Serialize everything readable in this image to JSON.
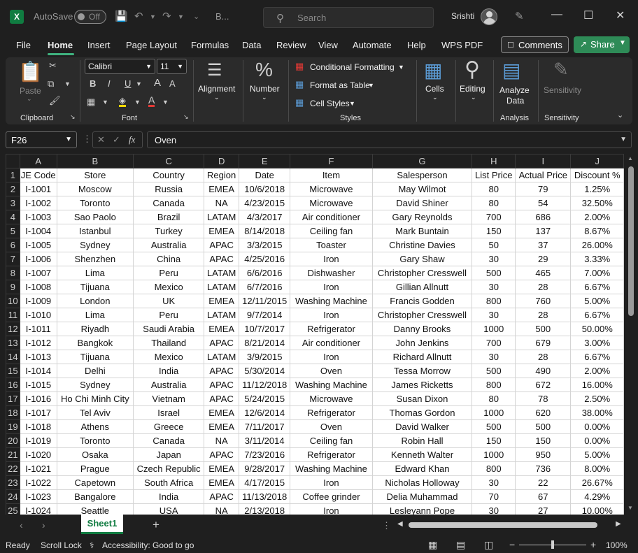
{
  "titlebar": {
    "app_icon": "X",
    "autosave_label": "AutoSave",
    "autosave_state": "Off",
    "file_name": "B...",
    "search_placeholder": "Search",
    "user_name": "Srishti"
  },
  "menu": [
    "File",
    "Home",
    "Insert",
    "Page Layout",
    "Formulas",
    "Data",
    "Review",
    "View",
    "Automate",
    "Help",
    "WPS PDF"
  ],
  "menu_active": "Home",
  "comments_label": "Comments",
  "share_label": "Share",
  "ribbon": {
    "paste_label": "Paste",
    "clipboard_label": "Clipboard",
    "font_name": "Calibri",
    "font_size": "11",
    "font_label": "Font",
    "bold": "B",
    "italic": "I",
    "underline": "U",
    "grow_font": "A",
    "shrink_font": "A",
    "alignment_label": "Alignment",
    "number_label": "Number",
    "conditional_formatting": "Conditional Formatting",
    "format_as_table": "Format as Table",
    "cell_styles": "Cell Styles",
    "styles_label": "Styles",
    "cells_label": "Cells",
    "editing_label": "Editing",
    "analyze_data_line1": "Analyze",
    "analyze_data_line2": "Data",
    "analysis_label": "Analysis",
    "sensitivity_btn": "Sensitivity",
    "sensitivity_label": "Sensitivity"
  },
  "formula_bar": {
    "name_box": "F26",
    "fx": "fx",
    "content": "Oven"
  },
  "columns": [
    "A",
    "B",
    "C",
    "D",
    "E",
    "F",
    "G",
    "H",
    "I",
    "J"
  ],
  "headers": [
    "JE Code",
    "Store",
    "Country",
    "Region",
    "Date",
    "Item",
    "Salesperson",
    "List Price",
    "Actual Price",
    "Discount %"
  ],
  "rows": [
    [
      "I-1001",
      "Moscow",
      "Russia",
      "EMEA",
      "10/6/2018",
      "Microwave",
      "May Wilmot",
      "80",
      "79",
      "1.25%"
    ],
    [
      "I-1002",
      "Toronto",
      "Canada",
      "NA",
      "4/23/2015",
      "Microwave",
      "David Shiner",
      "80",
      "54",
      "32.50%"
    ],
    [
      "I-1003",
      "Sao Paolo",
      "Brazil",
      "LATAM",
      "4/3/2017",
      "Air conditioner",
      "Gary Reynolds",
      "700",
      "686",
      "2.00%"
    ],
    [
      "I-1004",
      "Istanbul",
      "Turkey",
      "EMEA",
      "8/14/2018",
      "Ceiling fan",
      "Mark Buntain",
      "150",
      "137",
      "8.67%"
    ],
    [
      "I-1005",
      "Sydney",
      "Australia",
      "APAC",
      "3/3/2015",
      "Toaster",
      "Christine Davies",
      "50",
      "37",
      "26.00%"
    ],
    [
      "I-1006",
      "Shenzhen",
      "China",
      "APAC",
      "4/25/2016",
      "Iron",
      "Gary Shaw",
      "30",
      "29",
      "3.33%"
    ],
    [
      "I-1007",
      "Lima",
      "Peru",
      "LATAM",
      "6/6/2016",
      "Dishwasher",
      "Christopher Cresswell",
      "500",
      "465",
      "7.00%"
    ],
    [
      "I-1008",
      "Tijuana",
      "Mexico",
      "LATAM",
      "6/7/2016",
      "Iron",
      "Gillian Allnutt",
      "30",
      "28",
      "6.67%"
    ],
    [
      "I-1009",
      "London",
      "UK",
      "EMEA",
      "12/11/2015",
      "Washing Machine",
      "Francis Godden",
      "800",
      "760",
      "5.00%"
    ],
    [
      "I-1010",
      "Lima",
      "Peru",
      "LATAM",
      "9/7/2014",
      "Iron",
      "Christopher Cresswell",
      "30",
      "28",
      "6.67%"
    ],
    [
      "I-1011",
      "Riyadh",
      "Saudi Arabia",
      "EMEA",
      "10/7/2017",
      "Refrigerator",
      "Danny Brooks",
      "1000",
      "500",
      "50.00%"
    ],
    [
      "I-1012",
      "Bangkok",
      "Thailand",
      "APAC",
      "8/21/2014",
      "Air conditioner",
      "John Jenkins",
      "700",
      "679",
      "3.00%"
    ],
    [
      "I-1013",
      "Tijuana",
      "Mexico",
      "LATAM",
      "3/9/2015",
      "Iron",
      "Richard Allnutt",
      "30",
      "28",
      "6.67%"
    ],
    [
      "I-1014",
      "Delhi",
      "India",
      "APAC",
      "5/30/2014",
      "Oven",
      "Tessa Morrow",
      "500",
      "490",
      "2.00%"
    ],
    [
      "I-1015",
      "Sydney",
      "Australia",
      "APAC",
      "11/12/2018",
      "Washing Machine",
      "James Ricketts",
      "800",
      "672",
      "16.00%"
    ],
    [
      "I-1016",
      "Ho Chi Minh City",
      "Vietnam",
      "APAC",
      "5/24/2015",
      "Microwave",
      "Susan Dixon",
      "80",
      "78",
      "2.50%"
    ],
    [
      "I-1017",
      "Tel Aviv",
      "Israel",
      "EMEA",
      "12/6/2014",
      "Refrigerator",
      "Thomas Gordon",
      "1000",
      "620",
      "38.00%"
    ],
    [
      "I-1018",
      "Athens",
      "Greece",
      "EMEA",
      "7/11/2017",
      "Oven",
      "David Walker",
      "500",
      "500",
      "0.00%"
    ],
    [
      "I-1019",
      "Toronto",
      "Canada",
      "NA",
      "3/11/2014",
      "Ceiling fan",
      "Robin Hall",
      "150",
      "150",
      "0.00%"
    ],
    [
      "I-1020",
      "Osaka",
      "Japan",
      "APAC",
      "7/23/2016",
      "Refrigerator",
      "Kenneth Walter",
      "1000",
      "950",
      "5.00%"
    ],
    [
      "I-1021",
      "Prague",
      "Czech Republic",
      "EMEA",
      "9/28/2017",
      "Washing Machine",
      "Edward Khan",
      "800",
      "736",
      "8.00%"
    ],
    [
      "I-1022",
      "Capetown",
      "South Africa",
      "EMEA",
      "4/17/2015",
      "Iron",
      "Nicholas Holloway",
      "30",
      "22",
      "26.67%"
    ],
    [
      "I-1023",
      "Bangalore",
      "India",
      "APAC",
      "11/13/2018",
      "Coffee grinder",
      "Delia Muhammad",
      "70",
      "67",
      "4.29%"
    ],
    [
      "I-1024",
      "Seattle",
      "USA",
      "NA",
      "2/13/2018",
      "Iron",
      "Lesleyann Pope",
      "30",
      "27",
      "10.00%"
    ]
  ],
  "sheet_tab": "Sheet1",
  "status": {
    "ready": "Ready",
    "scroll_lock": "Scroll Lock",
    "accessibility": "Accessibility: Good to go",
    "zoom": "100%"
  },
  "colors": {
    "accent": "#107c41",
    "share": "#2e8b57",
    "background": "#1f1f1f",
    "ribbon": "#2b2b2b"
  }
}
